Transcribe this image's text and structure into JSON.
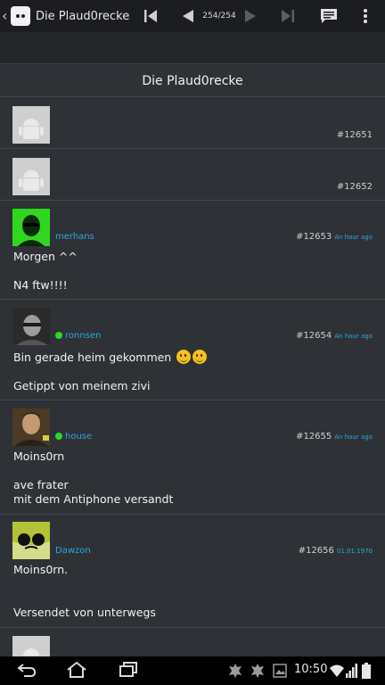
{
  "actionbar": {
    "title": "Die Plaud0recke",
    "page_counter": "254/254"
  },
  "thread": {
    "title": "Die Plaud0recke"
  },
  "posts": [
    {
      "number": "#12651",
      "user": "",
      "time": "",
      "online": false,
      "lines": []
    },
    {
      "number": "#12652",
      "user": "",
      "time": "",
      "online": false,
      "lines": []
    },
    {
      "number": "#12653",
      "user": "merhans",
      "time": "An hour ago",
      "online": false,
      "lines": [
        "Morgen ^^",
        "",
        "N4 ftw!!!!"
      ]
    },
    {
      "number": "#12654",
      "user": "ronnsen",
      "time": "An hour ago",
      "online": true,
      "lines": [
        "Bin gerade heim gekommen",
        "",
        "Getippt von meinem zivi"
      ]
    },
    {
      "number": "#12655",
      "user": "house",
      "time": "An hour ago",
      "online": true,
      "lines": [
        "Moins0rn",
        "",
        "ave frater",
        "mit dem Antiphone versandt"
      ]
    },
    {
      "number": "#12656",
      "user": "Dawzon",
      "time": "01.01.1970",
      "online": false,
      "lines": [
        "Moins0rn.",
        "",
        "",
        "Versendet von unterwegs"
      ]
    }
  ],
  "status": {
    "clock": "10:50"
  },
  "colors": {
    "background": "#2b2f33",
    "actionbar": "#1b1d20",
    "username": "#2ca7dd",
    "online": "#2bd82b",
    "avatar_merhans": "#31d620"
  },
  "icons": [
    "back-caret-icon",
    "app-logo-icon",
    "first-page-icon",
    "previous-page-icon",
    "next-page-icon",
    "last-page-icon",
    "reply-icon",
    "overflow-menu-icon",
    "default-avatar-icon",
    "emoji-smile-icon",
    "back-icon",
    "home-icon",
    "recent-apps-icon",
    "notification-icon",
    "image-notification-icon",
    "wifi-icon",
    "signal-icon",
    "battery-icon"
  ]
}
